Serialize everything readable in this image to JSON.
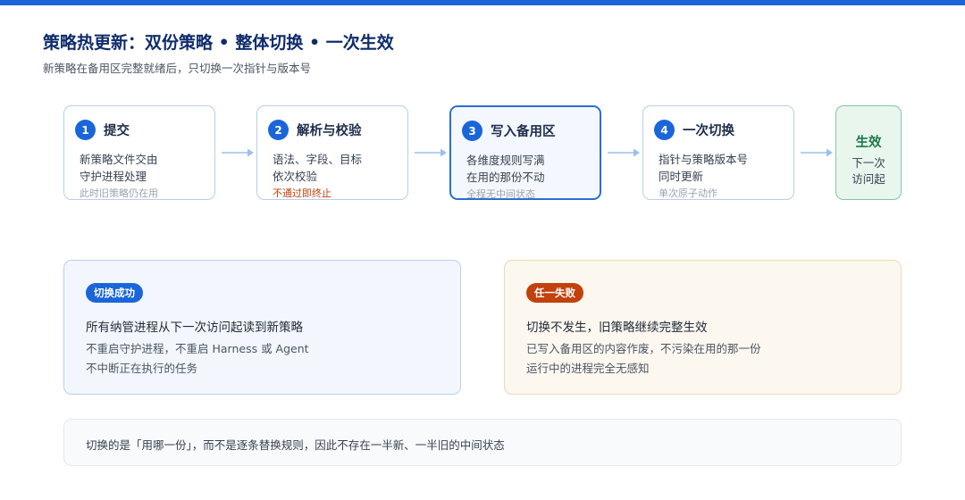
{
  "header": {
    "title": "策略热更新：双份策略 • 整体切换 • 一次生效",
    "subtitle": "新策略在备用区完整就绪后，只切换一次指针与版本号"
  },
  "steps": [
    {
      "num": "1",
      "title": "提交",
      "line1": "新策略文件交由",
      "line2": "守护进程处理",
      "note": "此时旧策略仍在用"
    },
    {
      "num": "2",
      "title": "解析与校验",
      "line1": "语法、字段、目标",
      "line2": "依次校验",
      "note": "不通过即终止"
    },
    {
      "num": "3",
      "title": "写入备用区",
      "line1": "各维度规则写满",
      "line2": "在用的那份不动",
      "note": "全程无中间状态"
    },
    {
      "num": "4",
      "title": "一次切换",
      "line1": "指针与策略版本号",
      "line2": "同时更新",
      "note": "单次原子动作"
    }
  ],
  "final": {
    "title": "生效",
    "line1": "下一次",
    "line2": "访问起"
  },
  "success": {
    "badge": "切换成功",
    "title": "所有纳管进程从下一次访问起读到新策略",
    "line1": "不重启守护进程，不重启 Harness 或 Agent",
    "line2": "不中断正在执行的任务"
  },
  "failure": {
    "badge": "任一失败",
    "title": "切换不发生，旧策略继续完整生效",
    "line1": "已写入备用区的内容作废，不污染在用的那一份",
    "line2": "运行中的进程完全无感知"
  },
  "footer": {
    "text": "切换的是「用哪一份」，而不是逐条替换规则，因此不存在一半新、一半旧的中间状态"
  },
  "colors": {
    "accent": "#1a66d9",
    "step_border": "#b7cdee",
    "active_border": "#2a6fd1",
    "success_green": "#1c7a47",
    "failure_orange": "#c2410c",
    "arrow": "#9cc0ee"
  }
}
